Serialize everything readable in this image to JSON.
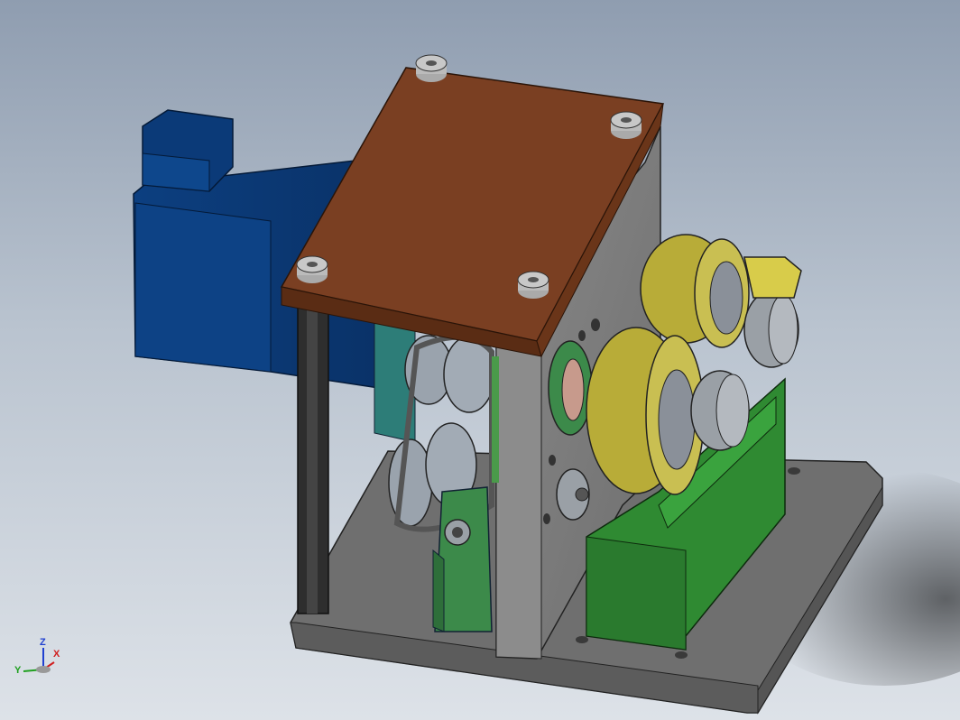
{
  "viewport": {
    "description_free": true,
    "colors": {
      "bg_top": "#8f9db0",
      "bg_bottom": "#dde2e8",
      "motor": "#0a3a78",
      "top_plate": "#7a3f22",
      "frame": "#7d7d7d",
      "base": "#6e6e6e",
      "roller_yellow": "#b8ac38",
      "green_bracket": "#2f8a32",
      "pulley": "#9aa3ad"
    }
  },
  "triad": {
    "x_label": "X",
    "y_label": "Y",
    "z_label": "Z",
    "x_color": "#d02020",
    "y_color": "#20a020",
    "z_color": "#2040d0"
  }
}
